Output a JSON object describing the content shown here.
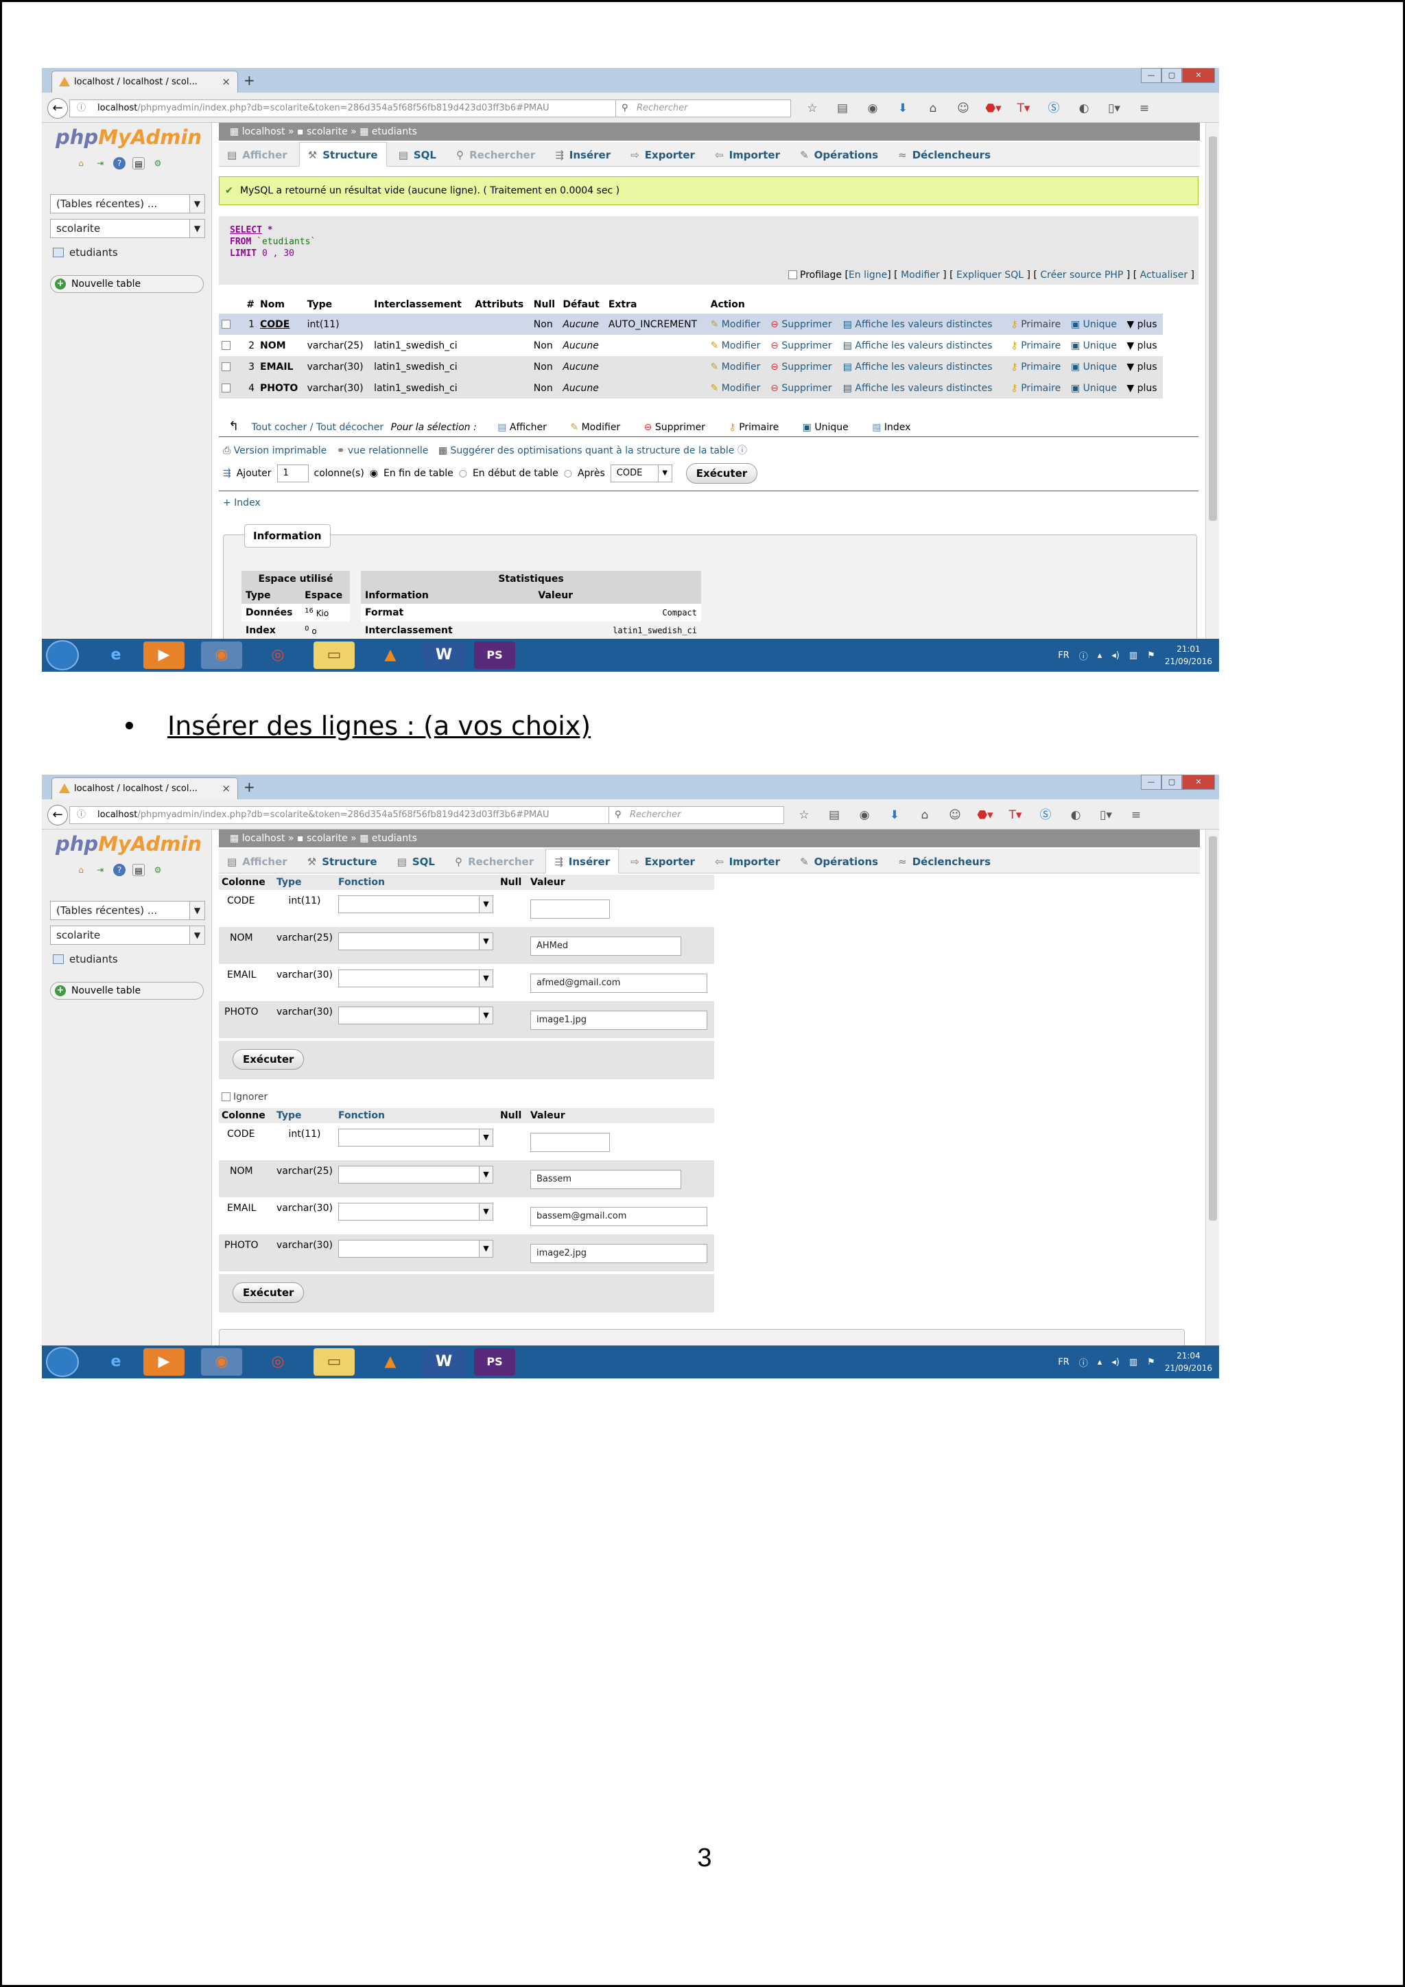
{
  "page_number": "3",
  "bullet": "Insérer des lignes : (a vos choix)",
  "browser": {
    "tab_title": "localhost / localhost / scol...",
    "url_host": "localhost",
    "url_path": "/phpmyadmin/index.php?db=scolarite&token=286d354a5f68f56fb819d423d03ff3b6#PMAU",
    "search_placeholder": "Rechercher"
  },
  "taskbar": {
    "lang": "FR",
    "time1": "21:01",
    "date1": "21/09/2016",
    "time2": "21:04",
    "date2": "21/09/2016"
  },
  "sidebar": {
    "logo_php": "php",
    "logo_my": "MyAdmin",
    "recent_tables": "(Tables récentes) ...",
    "db_select": "scolarite",
    "table_item": "etudiants",
    "new_table": "Nouvelle table"
  },
  "breadcrumb": {
    "server": "localhost",
    "database": "scolarite",
    "table": "etudiants"
  },
  "tabs": {
    "afficher": "Afficher",
    "structure": "Structure",
    "sql": "SQL",
    "rechercher": "Rechercher",
    "inserer": "Insérer",
    "exporter": "Exporter",
    "importer": "Importer",
    "operations": "Opérations",
    "declencheurs": "Déclencheurs"
  },
  "shot1": {
    "success_msg": "MySQL a retourné un résultat vide (aucune ligne). ( Traitement en 0.0004 sec )",
    "sql_select": "SELECT",
    "sql_star": "*",
    "sql_from": "FROM",
    "sql_table": "`etudiants`",
    "sql_limit": "LIMIT",
    "sql_limit_val": "0 , 30",
    "profilage": "Profilage",
    "links": [
      "En ligne",
      "Modifier",
      "Expliquer SQL",
      "Créer source PHP",
      "Actualiser"
    ],
    "headers": [
      "#",
      "Nom",
      "Type",
      "Interclassement",
      "Attributs",
      "Null",
      "Défaut",
      "Extra",
      "Action"
    ],
    "rows": [
      {
        "num": "1",
        "name": "CODE",
        "type": "int(11)",
        "coll": "",
        "null": "Non",
        "def": "Aucune",
        "extra": "AUTO_INCREMENT"
      },
      {
        "num": "2",
        "name": "NOM",
        "type": "varchar(25)",
        "coll": "latin1_swedish_ci",
        "null": "Non",
        "def": "Aucune",
        "extra": ""
      },
      {
        "num": "3",
        "name": "EMAIL",
        "type": "varchar(30)",
        "coll": "latin1_swedish_ci",
        "null": "Non",
        "def": "Aucune",
        "extra": ""
      },
      {
        "num": "4",
        "name": "PHOTO",
        "type": "varchar(30)",
        "coll": "latin1_swedish_ci",
        "null": "Non",
        "def": "Aucune",
        "extra": ""
      }
    ],
    "actions": {
      "modifier": "Modifier",
      "supprimer": "Supprimer",
      "distinct": "Affiche les valeurs distinctes",
      "primaire": "Primaire",
      "unique": "Unique",
      "plus": "plus"
    },
    "select_all": "Tout cocher / Tout décocher",
    "for_selection": "Pour la sélection :",
    "bulk": {
      "afficher": "Afficher",
      "modifier": "Modifier",
      "supprimer": "Supprimer",
      "primaire": "Primaire",
      "unique": "Unique",
      "index": "Index"
    },
    "print_version": "Version imprimable",
    "relational": "vue relationnelle",
    "suggest": "Suggérer des optimisations quant à la structure de la table",
    "add_label": "Ajouter",
    "add_value": "1",
    "columns_label": "colonne(s)",
    "end_of_table": "En fin de table",
    "start_of_table": "En début de table",
    "after": "Après",
    "after_select": "CODE",
    "execute": "Exécuter",
    "plus_index": "+ Index",
    "information": "Information",
    "space_used": "Espace utilisé",
    "statistics": "Statistiques",
    "space_headers": [
      "Type",
      "Espace"
    ],
    "space_rows": [
      [
        "Données",
        "16",
        "Kio"
      ],
      [
        "Index",
        "0",
        "o"
      ]
    ],
    "stat_headers": [
      "Information",
      "Valeur"
    ],
    "stat_rows": [
      [
        "Format",
        "Compact"
      ],
      [
        "Interclassement",
        "latin1_swedish_ci"
      ]
    ]
  },
  "shot2": {
    "headers": [
      "Colonne",
      "Type",
      "Fonction",
      "Null",
      "Valeur"
    ],
    "ignore": "Ignorer",
    "execute": "Exécuter",
    "form1": [
      {
        "col": "CODE",
        "type": "int(11)",
        "value": ""
      },
      {
        "col": "NOM",
        "type": "varchar(25)",
        "value": "AHMed"
      },
      {
        "col": "EMAIL",
        "type": "varchar(30)",
        "value": "afmed@gmail.com"
      },
      {
        "col": "PHOTO",
        "type": "varchar(30)",
        "value": "image1.jpg"
      }
    ],
    "form2": [
      {
        "col": "CODE",
        "type": "int(11)",
        "value": ""
      },
      {
        "col": "NOM",
        "type": "varchar(25)",
        "value": "Bassem"
      },
      {
        "col": "EMAIL",
        "type": "varchar(30)",
        "value": "bassem@gmail.com"
      },
      {
        "col": "PHOTO",
        "type": "varchar(30)",
        "value": "image2.jpg"
      }
    ]
  }
}
